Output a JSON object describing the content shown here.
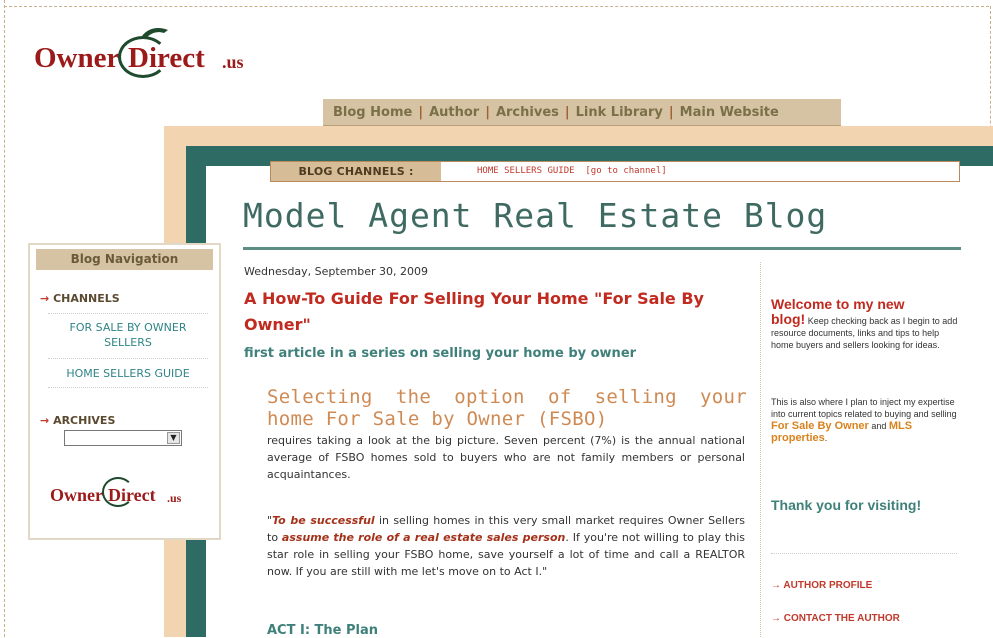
{
  "logo": {
    "word1": "Owner",
    "word2": "Direct",
    "word3": ".us"
  },
  "topnav": [
    {
      "label": "Blog Home"
    },
    {
      "label": "Author"
    },
    {
      "label": "Archives"
    },
    {
      "label": "Link Library"
    },
    {
      "label": "Main Website"
    }
  ],
  "channels": {
    "label": "BLOG CHANNELS :",
    "current": "HOME SELLERS GUIDE",
    "goto": "[go to channel]"
  },
  "blog_title": "Model Agent Real Estate Blog",
  "sidebar": {
    "header": "Blog Navigation",
    "channels_label": "CHANNELS",
    "channels": [
      {
        "label": "FOR SALE BY OWNER SELLERS"
      },
      {
        "label": "HOME SELLERS GUIDE"
      }
    ],
    "archives_label": "ARCHIVES",
    "archives_select_value": "",
    "arrow": "→"
  },
  "post": {
    "date": "Wednesday, September 30, 2009",
    "title": "A How-To Guide For Selling Your Home \"For Sale By Owner\"",
    "subtitle": "first article in a series on selling your home by owner",
    "lead": "Selecting the option of selling your home For Sale by Owner (FSBO)",
    "p1": "requires taking a look at the big picture. Seven percent (7%) is the annual national average of FSBO homes sold to buyers who are not family members or personal acquaintances.",
    "p2_open_quote": "\"",
    "p2_em1": "To be successful",
    "p2_mid1": " in selling homes in this very small market requires Owner Sellers to ",
    "p2_em2": "assume the role of a real estate sales person",
    "p2_rest": ". If you're not willing to play this star role in selling your FSBO home, save yourself a lot of time and call a REALTOR now. If you are still with me let's move on to Act I.\"",
    "act": "ACT I: The Plan"
  },
  "right": {
    "welcome": "Welcome to my new",
    "blog": "blog!",
    "welcome_text": " Keep checking back as I begin to add resource documents, links and tips to help home buyers and sellers looking for ideas.",
    "inject_text": "This is also where I plan to inject my expertise into current topics related to buying and selling ",
    "fsbo": "For Sale By Owner",
    "and": " and ",
    "mls": "MLS properties",
    "period": ".",
    "thanks": "Thank you for visiting!",
    "links": [
      {
        "label": "AUTHOR PROFILE"
      },
      {
        "label": "CONTACT THE AUTHOR"
      }
    ]
  },
  "colors": {
    "accent_red": "#c02a1f",
    "teal": "#3f807b",
    "tan": "#d6c3a4",
    "frame_teal": "#2f6b65"
  }
}
